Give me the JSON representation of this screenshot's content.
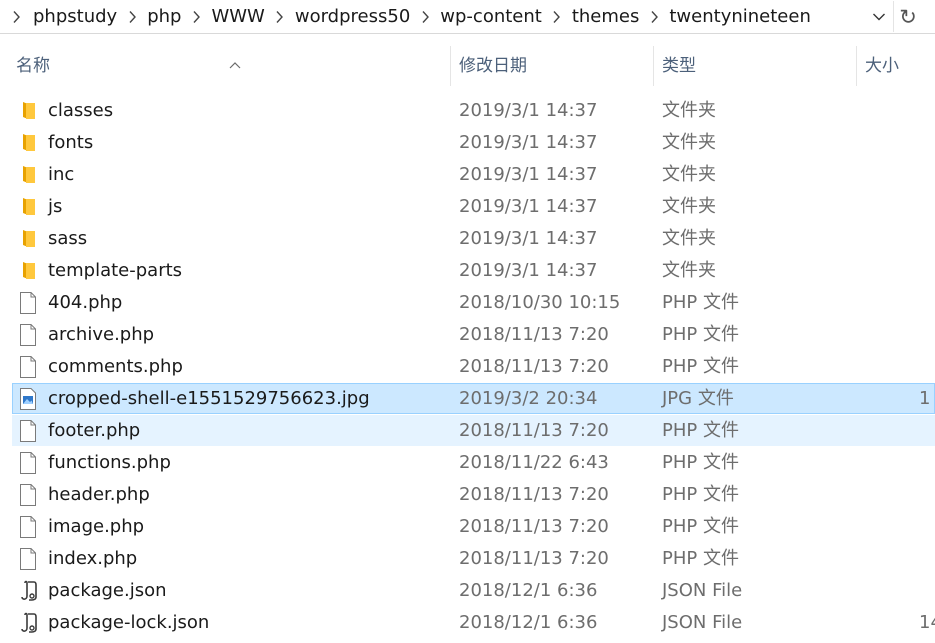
{
  "address_bar": {
    "crumbs": [
      "phpstudy",
      "php",
      "WWW",
      "wordpress50",
      "wp-content",
      "themes",
      "twentynineteen"
    ],
    "separator_icon": "chevron-right-icon",
    "dropdown_icon": "chevron-down-icon",
    "refresh_icon": "refresh-icon",
    "refresh_glyph": "↻"
  },
  "columns": {
    "name": "名称",
    "date_modified": "修改日期",
    "type": "类型",
    "size": "大小"
  },
  "files": [
    {
      "name": "classes",
      "date": "2019/3/1 14:37",
      "type": "文件夹",
      "size": "",
      "icon": "folder-icon",
      "state": ""
    },
    {
      "name": "fonts",
      "date": "2019/3/1 14:37",
      "type": "文件夹",
      "size": "",
      "icon": "folder-icon",
      "state": ""
    },
    {
      "name": "inc",
      "date": "2019/3/1 14:37",
      "type": "文件夹",
      "size": "",
      "icon": "folder-icon",
      "state": ""
    },
    {
      "name": "js",
      "date": "2019/3/1 14:37",
      "type": "文件夹",
      "size": "",
      "icon": "folder-icon",
      "state": ""
    },
    {
      "name": "sass",
      "date": "2019/3/1 14:37",
      "type": "文件夹",
      "size": "",
      "icon": "folder-icon",
      "state": ""
    },
    {
      "name": "template-parts",
      "date": "2019/3/1 14:37",
      "type": "文件夹",
      "size": "",
      "icon": "folder-icon",
      "state": ""
    },
    {
      "name": "404.php",
      "date": "2018/10/30 10:15",
      "type": "PHP 文件",
      "size": "",
      "icon": "file-icon",
      "state": ""
    },
    {
      "name": "archive.php",
      "date": "2018/11/13 7:20",
      "type": "PHP 文件",
      "size": "",
      "icon": "file-icon",
      "state": ""
    },
    {
      "name": "comments.php",
      "date": "2018/11/13 7:20",
      "type": "PHP 文件",
      "size": "",
      "icon": "file-icon",
      "state": ""
    },
    {
      "name": "cropped-shell-e1551529756623.jpg",
      "date": "2019/3/2 20:34",
      "type": "JPG 文件",
      "size": "1",
      "icon": "image-file-icon",
      "state": "selected"
    },
    {
      "name": "footer.php",
      "date": "2018/11/13 7:20",
      "type": "PHP 文件",
      "size": "",
      "icon": "file-icon",
      "state": "hover"
    },
    {
      "name": "functions.php",
      "date": "2018/11/22 6:43",
      "type": "PHP 文件",
      "size": "",
      "icon": "file-icon",
      "state": ""
    },
    {
      "name": "header.php",
      "date": "2018/11/13 7:20",
      "type": "PHP 文件",
      "size": "",
      "icon": "file-icon",
      "state": ""
    },
    {
      "name": "image.php",
      "date": "2018/11/13 7:20",
      "type": "PHP 文件",
      "size": "",
      "icon": "file-icon",
      "state": ""
    },
    {
      "name": "index.php",
      "date": "2018/11/13 7:20",
      "type": "PHP 文件",
      "size": "",
      "icon": "file-icon",
      "state": ""
    },
    {
      "name": "package.json",
      "date": "2018/12/1 6:36",
      "type": "JSON File",
      "size": "",
      "icon": "json-file-icon",
      "state": ""
    },
    {
      "name": "package-lock.json",
      "date": "2018/12/1 6:36",
      "type": "JSON File",
      "size": "14",
      "icon": "json-file-icon",
      "state": ""
    }
  ],
  "colors": {
    "folder": "#ffc83d",
    "folder_dark": "#e8a200",
    "selected_bg": "#cce8ff",
    "selected_border": "#99d1ff",
    "hover_bg": "#e5f3ff",
    "header_text": "#4c607a",
    "meta_text": "#6d6d6d"
  }
}
